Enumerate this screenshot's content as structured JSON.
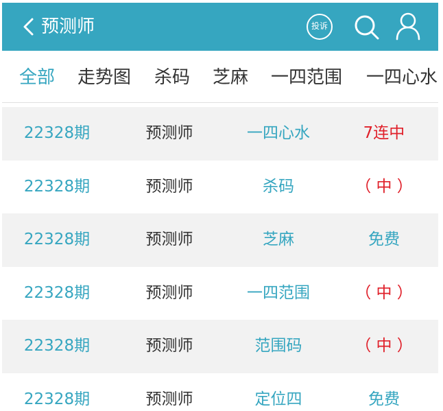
{
  "header": {
    "title": "预测师",
    "complaint_label": "投诉"
  },
  "tabs": [
    {
      "label": "全部",
      "active": true
    },
    {
      "label": "走势图",
      "active": false
    },
    {
      "label": "杀码",
      "active": false
    },
    {
      "label": "芝麻",
      "active": false
    },
    {
      "label": "一四范围",
      "active": false
    },
    {
      "label": "一四心水",
      "active": false
    }
  ],
  "rows": [
    {
      "period": "22328期",
      "author": "预测师",
      "type": "一四心水",
      "result": "7连中",
      "result_color": "red"
    },
    {
      "period": "22328期",
      "author": "预测师",
      "type": "杀码",
      "result": "（ 中 ）",
      "result_color": "red"
    },
    {
      "period": "22328期",
      "author": "预测师",
      "type": "芝麻",
      "result": "免费",
      "result_color": "blue"
    },
    {
      "period": "22328期",
      "author": "预测师",
      "type": "一四范围",
      "result": "（ 中 ）",
      "result_color": "red"
    },
    {
      "period": "22328期",
      "author": "预测师",
      "type": "范围码",
      "result": "（ 中 ）",
      "result_color": "red"
    },
    {
      "period": "22328期",
      "author": "预测师",
      "type": "定位四",
      "result": "免费",
      "result_color": "blue"
    }
  ],
  "colors": {
    "brand": "#36a6c0",
    "highlight_red": "#e0202a",
    "row_alt_bg": "#f2f2f2"
  }
}
